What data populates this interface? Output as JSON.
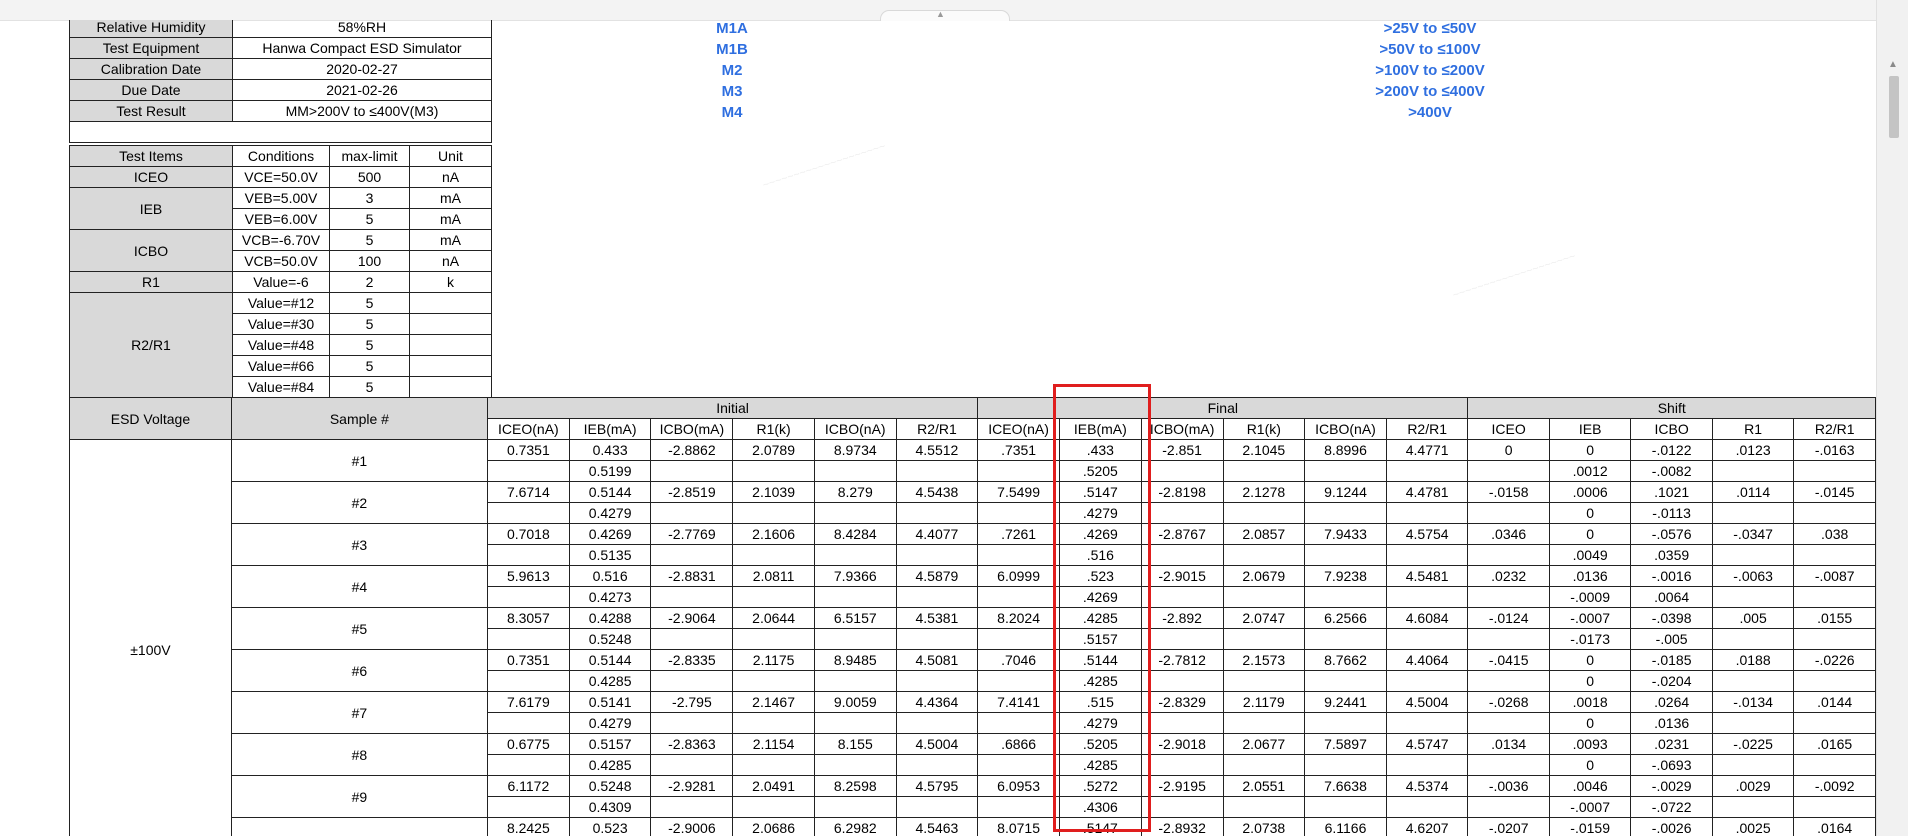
{
  "info": [
    {
      "label": "Relative Humidity",
      "value": "58%RH"
    },
    {
      "label": "Test Equipment",
      "value": "Hanwa Compact ESD Simulator"
    },
    {
      "label": "Calibration Date",
      "value": "2020-02-27"
    },
    {
      "label": "Due Date",
      "value": "2021-02-26"
    },
    {
      "label": "Test Result",
      "value": "MM>200V to ≤400V(M3)"
    }
  ],
  "mm_classes": [
    {
      "cls": "M1A",
      "range": ">25V to ≤50V"
    },
    {
      "cls": "M1B",
      "range": ">50V to ≤100V"
    },
    {
      "cls": "M2",
      "range": ">100V to ≤200V"
    },
    {
      "cls": "M3",
      "range": ">200V to ≤400V"
    },
    {
      "cls": "M4",
      "range": ">400V"
    }
  ],
  "limits": {
    "headers": [
      "Test Items",
      "Conditions",
      "max-limit",
      "Unit"
    ],
    "rows": [
      {
        "item": "ICEO",
        "span": 1,
        "cond": "VCE=50.0V",
        "max": "500",
        "unit": "nA"
      },
      {
        "item": "IEB",
        "span": 2,
        "cond": "VEB=5.00V",
        "max": "3",
        "unit": "mA"
      },
      {
        "item": "",
        "span": 0,
        "cond": "VEB=6.00V",
        "max": "5",
        "unit": "mA"
      },
      {
        "item": "ICBO",
        "span": 2,
        "cond": "VCB=-6.70V",
        "max": "5",
        "unit": "mA"
      },
      {
        "item": "",
        "span": 0,
        "cond": "VCB=50.0V",
        "max": "100",
        "unit": "nA"
      },
      {
        "item": "R1",
        "span": 1,
        "cond": "Value=-6",
        "max": "2",
        "unit": "k"
      },
      {
        "item": "R2/R1",
        "span": 5,
        "cond": "Value=#12",
        "max": "5",
        "unit": ""
      },
      {
        "item": "",
        "span": 0,
        "cond": "Value=#30",
        "max": "5",
        "unit": ""
      },
      {
        "item": "",
        "span": 0,
        "cond": "Value=#48",
        "max": "5",
        "unit": ""
      },
      {
        "item": "",
        "span": 0,
        "cond": "Value=#66",
        "max": "5",
        "unit": ""
      },
      {
        "item": "",
        "span": 0,
        "cond": "Value=#84",
        "max": "5",
        "unit": ""
      }
    ]
  },
  "main": {
    "esd_label": "ESD Voltage",
    "sample_label": "Sample #",
    "groups": [
      "Initial",
      "Final",
      "Shift"
    ],
    "initial_cols": [
      "ICEO(nA)",
      "IEB(mA)",
      "ICBO(mA)",
      "R1(k)",
      "ICBO(nA)",
      "R2/R1"
    ],
    "final_cols": [
      "ICEO(nA)",
      "IEB(mA)",
      "ICBO(mA)",
      "R1(k)",
      "ICBO(nA)",
      "R2/R1"
    ],
    "shift_cols": [
      "ICEO",
      "IEB",
      "ICBO",
      "R1",
      "R2/R1"
    ],
    "esd_voltage": "±100V",
    "samples": [
      {
        "id": "#1",
        "r1": [
          "0.7351",
          "0.433",
          "-2.8862",
          "2.0789",
          "8.9734",
          "4.5512",
          ".7351",
          ".433",
          "-2.851",
          "2.1045",
          "8.8996",
          "4.4771",
          "0",
          "0",
          "-.0122",
          ".0123",
          "-.0163"
        ],
        "r2": [
          "",
          "0.5199",
          "",
          "",
          "",
          "",
          "",
          ".5205",
          "",
          "",
          "",
          "",
          "",
          ".0012",
          "-.0082",
          "",
          ""
        ]
      },
      {
        "id": "#2",
        "r1": [
          "7.6714",
          "0.5144",
          "-2.8519",
          "2.1039",
          "8.279",
          "4.5438",
          "7.5499",
          ".5147",
          "-2.8198",
          "2.1278",
          "9.1244",
          "4.4781",
          "-.0158",
          ".0006",
          ".1021",
          ".0114",
          "-.0145"
        ],
        "r2": [
          "",
          "0.4279",
          "",
          "",
          "",
          "",
          "",
          ".4279",
          "",
          "",
          "",
          "",
          "",
          "0",
          "-.0113",
          "",
          ""
        ]
      },
      {
        "id": "#3",
        "r1": [
          "0.7018",
          "0.4269",
          "-2.7769",
          "2.1606",
          "8.4284",
          "4.4077",
          ".7261",
          ".4269",
          "-2.8767",
          "2.0857",
          "7.9433",
          "4.5754",
          ".0346",
          "0",
          "-.0576",
          "-.0347",
          ".038"
        ],
        "r2": [
          "",
          "0.5135",
          "",
          "",
          "",
          "",
          "",
          ".516",
          "",
          "",
          "",
          "",
          "",
          ".0049",
          ".0359",
          "",
          ""
        ]
      },
      {
        "id": "#4",
        "r1": [
          "5.9613",
          "0.516",
          "-2.8831",
          "2.0811",
          "7.9366",
          "4.5879",
          "6.0999",
          ".523",
          "-2.9015",
          "2.0679",
          "7.9238",
          "4.5481",
          ".0232",
          ".0136",
          "-.0016",
          "-.0063",
          "-.0087"
        ],
        "r2": [
          "",
          "0.4273",
          "",
          "",
          "",
          "",
          "",
          ".4269",
          "",
          "",
          "",
          "",
          "",
          "-.0009",
          ".0064",
          "",
          ""
        ]
      },
      {
        "id": "#5",
        "r1": [
          "8.3057",
          "0.4288",
          "-2.9064",
          "2.0644",
          "6.5157",
          "4.5381",
          "8.2024",
          ".4285",
          "-2.892",
          "2.0747",
          "6.2566",
          "4.6084",
          "-.0124",
          "-.0007",
          "-.0398",
          ".005",
          ".0155"
        ],
        "r2": [
          "",
          "0.5248",
          "",
          "",
          "",
          "",
          "",
          ".5157",
          "",
          "",
          "",
          "",
          "",
          "-.0173",
          "-.005",
          "",
          ""
        ]
      },
      {
        "id": "#6",
        "r1": [
          "0.7351",
          "0.5144",
          "-2.8335",
          "2.1175",
          "8.9485",
          "4.5081",
          ".7046",
          ".5144",
          "-2.7812",
          "2.1573",
          "8.7662",
          "4.4064",
          "-.0415",
          "0",
          "-.0185",
          ".0188",
          "-.0226"
        ],
        "r2": [
          "",
          "0.4285",
          "",
          "",
          "",
          "",
          "",
          ".4285",
          "",
          "",
          "",
          "",
          "",
          "0",
          "-.0204",
          "",
          ""
        ]
      },
      {
        "id": "#7",
        "r1": [
          "7.6179",
          "0.5141",
          "-2.795",
          "2.1467",
          "9.0059",
          "4.4364",
          "7.4141",
          ".515",
          "-2.8329",
          "2.1179",
          "9.2441",
          "4.5004",
          "-.0268",
          ".0018",
          ".0264",
          "-.0134",
          ".0144"
        ],
        "r2": [
          "",
          "0.4279",
          "",
          "",
          "",
          "",
          "",
          ".4279",
          "",
          "",
          "",
          "",
          "",
          "0",
          ".0136",
          "",
          ""
        ]
      },
      {
        "id": "#8",
        "r1": [
          "0.6775",
          "0.5157",
          "-2.8363",
          "2.1154",
          "8.155",
          "4.5004",
          ".6866",
          ".5205",
          "-2.9018",
          "2.0677",
          "7.5897",
          "4.5747",
          ".0134",
          ".0093",
          ".0231",
          "-.0225",
          ".0165"
        ],
        "r2": [
          "",
          "0.4285",
          "",
          "",
          "",
          "",
          "",
          ".4285",
          "",
          "",
          "",
          "",
          "",
          "0",
          "-.0693",
          "",
          ""
        ]
      },
      {
        "id": "#9",
        "r1": [
          "6.1172",
          "0.5248",
          "-2.9281",
          "2.0491",
          "8.2598",
          "4.5795",
          "6.0953",
          ".5272",
          "-2.9195",
          "2.0551",
          "7.6638",
          "4.5374",
          "-.0036",
          ".0046",
          "-.0029",
          ".0029",
          "-.0092"
        ],
        "r2": [
          "",
          "0.4309",
          "",
          "",
          "",
          "",
          "",
          ".4306",
          "",
          "",
          "",
          "",
          "",
          "-.0007",
          "-.0722",
          "",
          ""
        ]
      },
      {
        "id": "",
        "r1": [
          "8.2425",
          "0.523",
          "-2.9006",
          "2.0686",
          "6.2982",
          "4.5463",
          "8.0715",
          ".5147",
          "-2.8932",
          "2.0738",
          "6.1166",
          "4.6207",
          "-.0207",
          "-.0159",
          "-.0026",
          ".0025",
          ".0164"
        ],
        "r2": [
          "",
          "",
          "",
          "",
          "",
          "",
          "",
          "",
          "",
          "",
          "",
          "",
          "",
          "",
          "",
          "",
          ""
        ]
      }
    ]
  }
}
